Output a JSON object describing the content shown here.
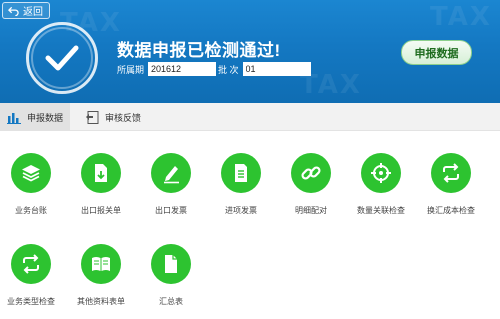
{
  "header": {
    "back_label": "返回",
    "title": "数据申报已检测通过!",
    "period_label": "所属期",
    "period_value": "201612",
    "batch_label": "批 次",
    "batch_value": "01",
    "report_button": "申报数据",
    "watermark": "TAX"
  },
  "tabs": [
    {
      "label": "申报数据",
      "icon": "bar-chart-icon",
      "active": true
    },
    {
      "label": "审核反馈",
      "icon": "feedback-doc-icon",
      "active": false
    }
  ],
  "functions": [
    {
      "label": "业务台账",
      "icon": "layers-icon"
    },
    {
      "label": "出口报关单",
      "icon": "document-download-icon"
    },
    {
      "label": "出口发票",
      "icon": "pen-edit-icon"
    },
    {
      "label": "进项发票",
      "icon": "document-lines-icon"
    },
    {
      "label": "明细配对",
      "icon": "link-icon"
    },
    {
      "label": "数量关联检查",
      "icon": "crosshair-icon"
    },
    {
      "label": "换汇成本检查",
      "icon": "exchange-arrows-icon"
    },
    {
      "label": "业务类型检查",
      "icon": "exchange-arrows-icon"
    },
    {
      "label": "其他资料表单",
      "icon": "open-book-icon"
    },
    {
      "label": "汇总表",
      "icon": "document-icon"
    }
  ],
  "colors": {
    "banner": "#1478c2",
    "icon_green": "#2dc330",
    "report_button_text": "#1e6b1e"
  }
}
